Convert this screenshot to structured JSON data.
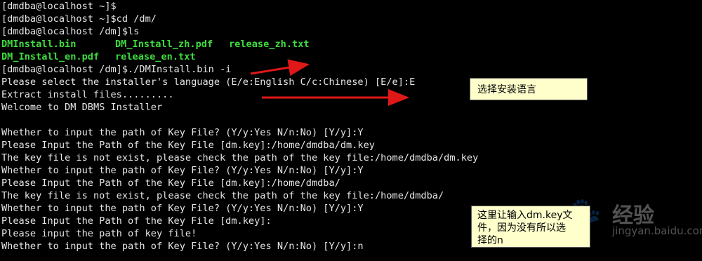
{
  "terminal": {
    "lines": [
      "[dmdba@localhost ~]$",
      "[dmdba@localhost ~]$cd /dm/",
      "[dmdba@localhost /dm]$ls",
      "",
      "",
      "[dmdba@localhost /dm]$./DMInstall.bin -i",
      "Please select the installer's language (E/e:English C/c:Chinese) [E/e]:E",
      "Extract install files.........",
      "Welcome to DM DBMS Installer",
      "",
      "Whether to input the path of Key File? (Y/y:Yes N/n:No) [Y/y]:Y",
      "Please Input the Path of the Key File [dm.key]:/home/dmdba/dm.key",
      "The key file is not exist, please check the path of the key file:/home/dmdba/dm.key",
      "Whether to input the path of Key File? (Y/y:Yes N/n:No) [Y/y]:Y",
      "Please Input the Path of the Key File [dm.key]:/home/dmdba/",
      "The key file is not exist, please check the path of the key file:/home/dmdba/",
      "Whether to input the path of Key File? (Y/y:Yes N/n:No) [Y/y]:Y",
      "Please Input the Path of the Key File [dm.key]:",
      "Please input the path of key file!",
      "Whether to input the path of Key File? (Y/y:Yes N/n:No) [Y/y]:n"
    ],
    "listing_row1": [
      "DMInstall.bin",
      "DM_Install_zh.pdf",
      "release_zh.txt"
    ],
    "listing_row2": [
      "DM_Install_en.pdf",
      "release_en.txt"
    ]
  },
  "annotations": {
    "lang_note": "选择安装语言",
    "key_note_line1": "这里让输入dm.key文",
    "key_note_line2": "件，因为没有所以选",
    "key_note_line3": "择的n"
  },
  "watermark": {
    "brand": "经验",
    "url": "jingyan.baidu.com"
  },
  "colors": {
    "background": "#000000",
    "text": "#e6e6e6",
    "file_listing": "#3fdc3f",
    "arrow": "#e01818",
    "callout_bg": "#ffffcc"
  }
}
